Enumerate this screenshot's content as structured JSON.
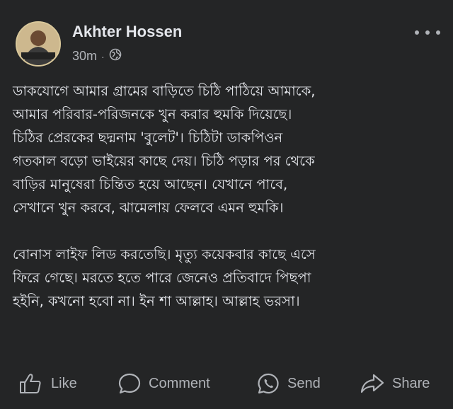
{
  "post": {
    "author": "Akhter Hossen",
    "time": "30m",
    "separator": "·",
    "visibility_icon": "globe-icon",
    "paragraphs": [
      "ডাকযোগে আমার গ্রামের বাড়িতে চিঠি পাঠিয়ে আমাকে,\nআমার পরিবার-পরিজনকে খুন করার হুমকি দিয়েছে।\nচিঠির প্রেরকের ছদ্মনাম 'বুলেট'। চিঠিটা ডাকপিওন\nগতকাল বড়ো ভাইয়ের কাছে দেয়। চিঠি পড়ার পর থেকে\nবাড়ির মানুষেরা চিন্তিত হয়ে আছেন। যেখানে পাবে,\nসেখানে খুন করবে, ঝামেলায় ফেলবে এমন হুমকি।",
      "বোনাস লাইফ লিড করতেছি। মৃত্যু কয়েকবার কাছে এসে\nফিরে গেছে। মরতে হতে পারে জেনেও প্রতিবাদে পিছপা\nহইনি, কখনো হবো না। ইন শা আল্লাহ। আল্লাহ ভরসা।"
    ]
  },
  "actions": {
    "like": "Like",
    "comment": "Comment",
    "send": "Send",
    "share": "Share"
  },
  "colors": {
    "background": "#242526",
    "text": "#e4e6eb",
    "secondary": "#b0b3b8"
  }
}
